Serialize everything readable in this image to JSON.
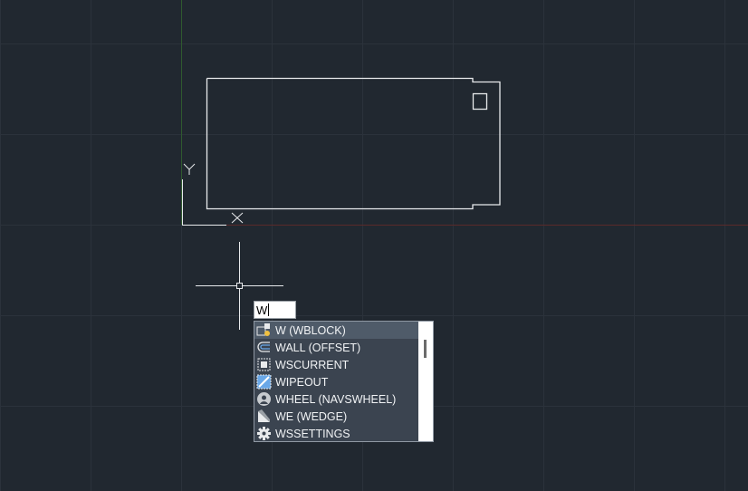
{
  "axis": {
    "y_label": "Y",
    "x_label": "X"
  },
  "command_line": {
    "value": "W"
  },
  "autocomplete": {
    "items": [
      {
        "label": "W (WBLOCK)",
        "icon": "wblock-icon",
        "selected": true
      },
      {
        "label": "WALL (OFFSET)",
        "icon": "offset-icon",
        "selected": false
      },
      {
        "label": "WSCURRENT",
        "icon": "workspace-icon",
        "selected": false
      },
      {
        "label": "WIPEOUT",
        "icon": "wipeout-icon",
        "selected": false
      },
      {
        "label": "WHEEL (NAVSWHEEL)",
        "icon": "navwheel-icon",
        "selected": false
      },
      {
        "label": "WE (WEDGE)",
        "icon": "wedge-icon",
        "selected": false
      },
      {
        "label": "WSSETTINGS",
        "icon": "gear-icon",
        "selected": false
      }
    ]
  },
  "colors": {
    "background": "#212830",
    "grid": "#2b323b",
    "x_axis": "#5a2a2a",
    "y_axis": "#2f5a2f",
    "drawing": "#e8eaec",
    "annotation_arrow": "#e02020"
  }
}
